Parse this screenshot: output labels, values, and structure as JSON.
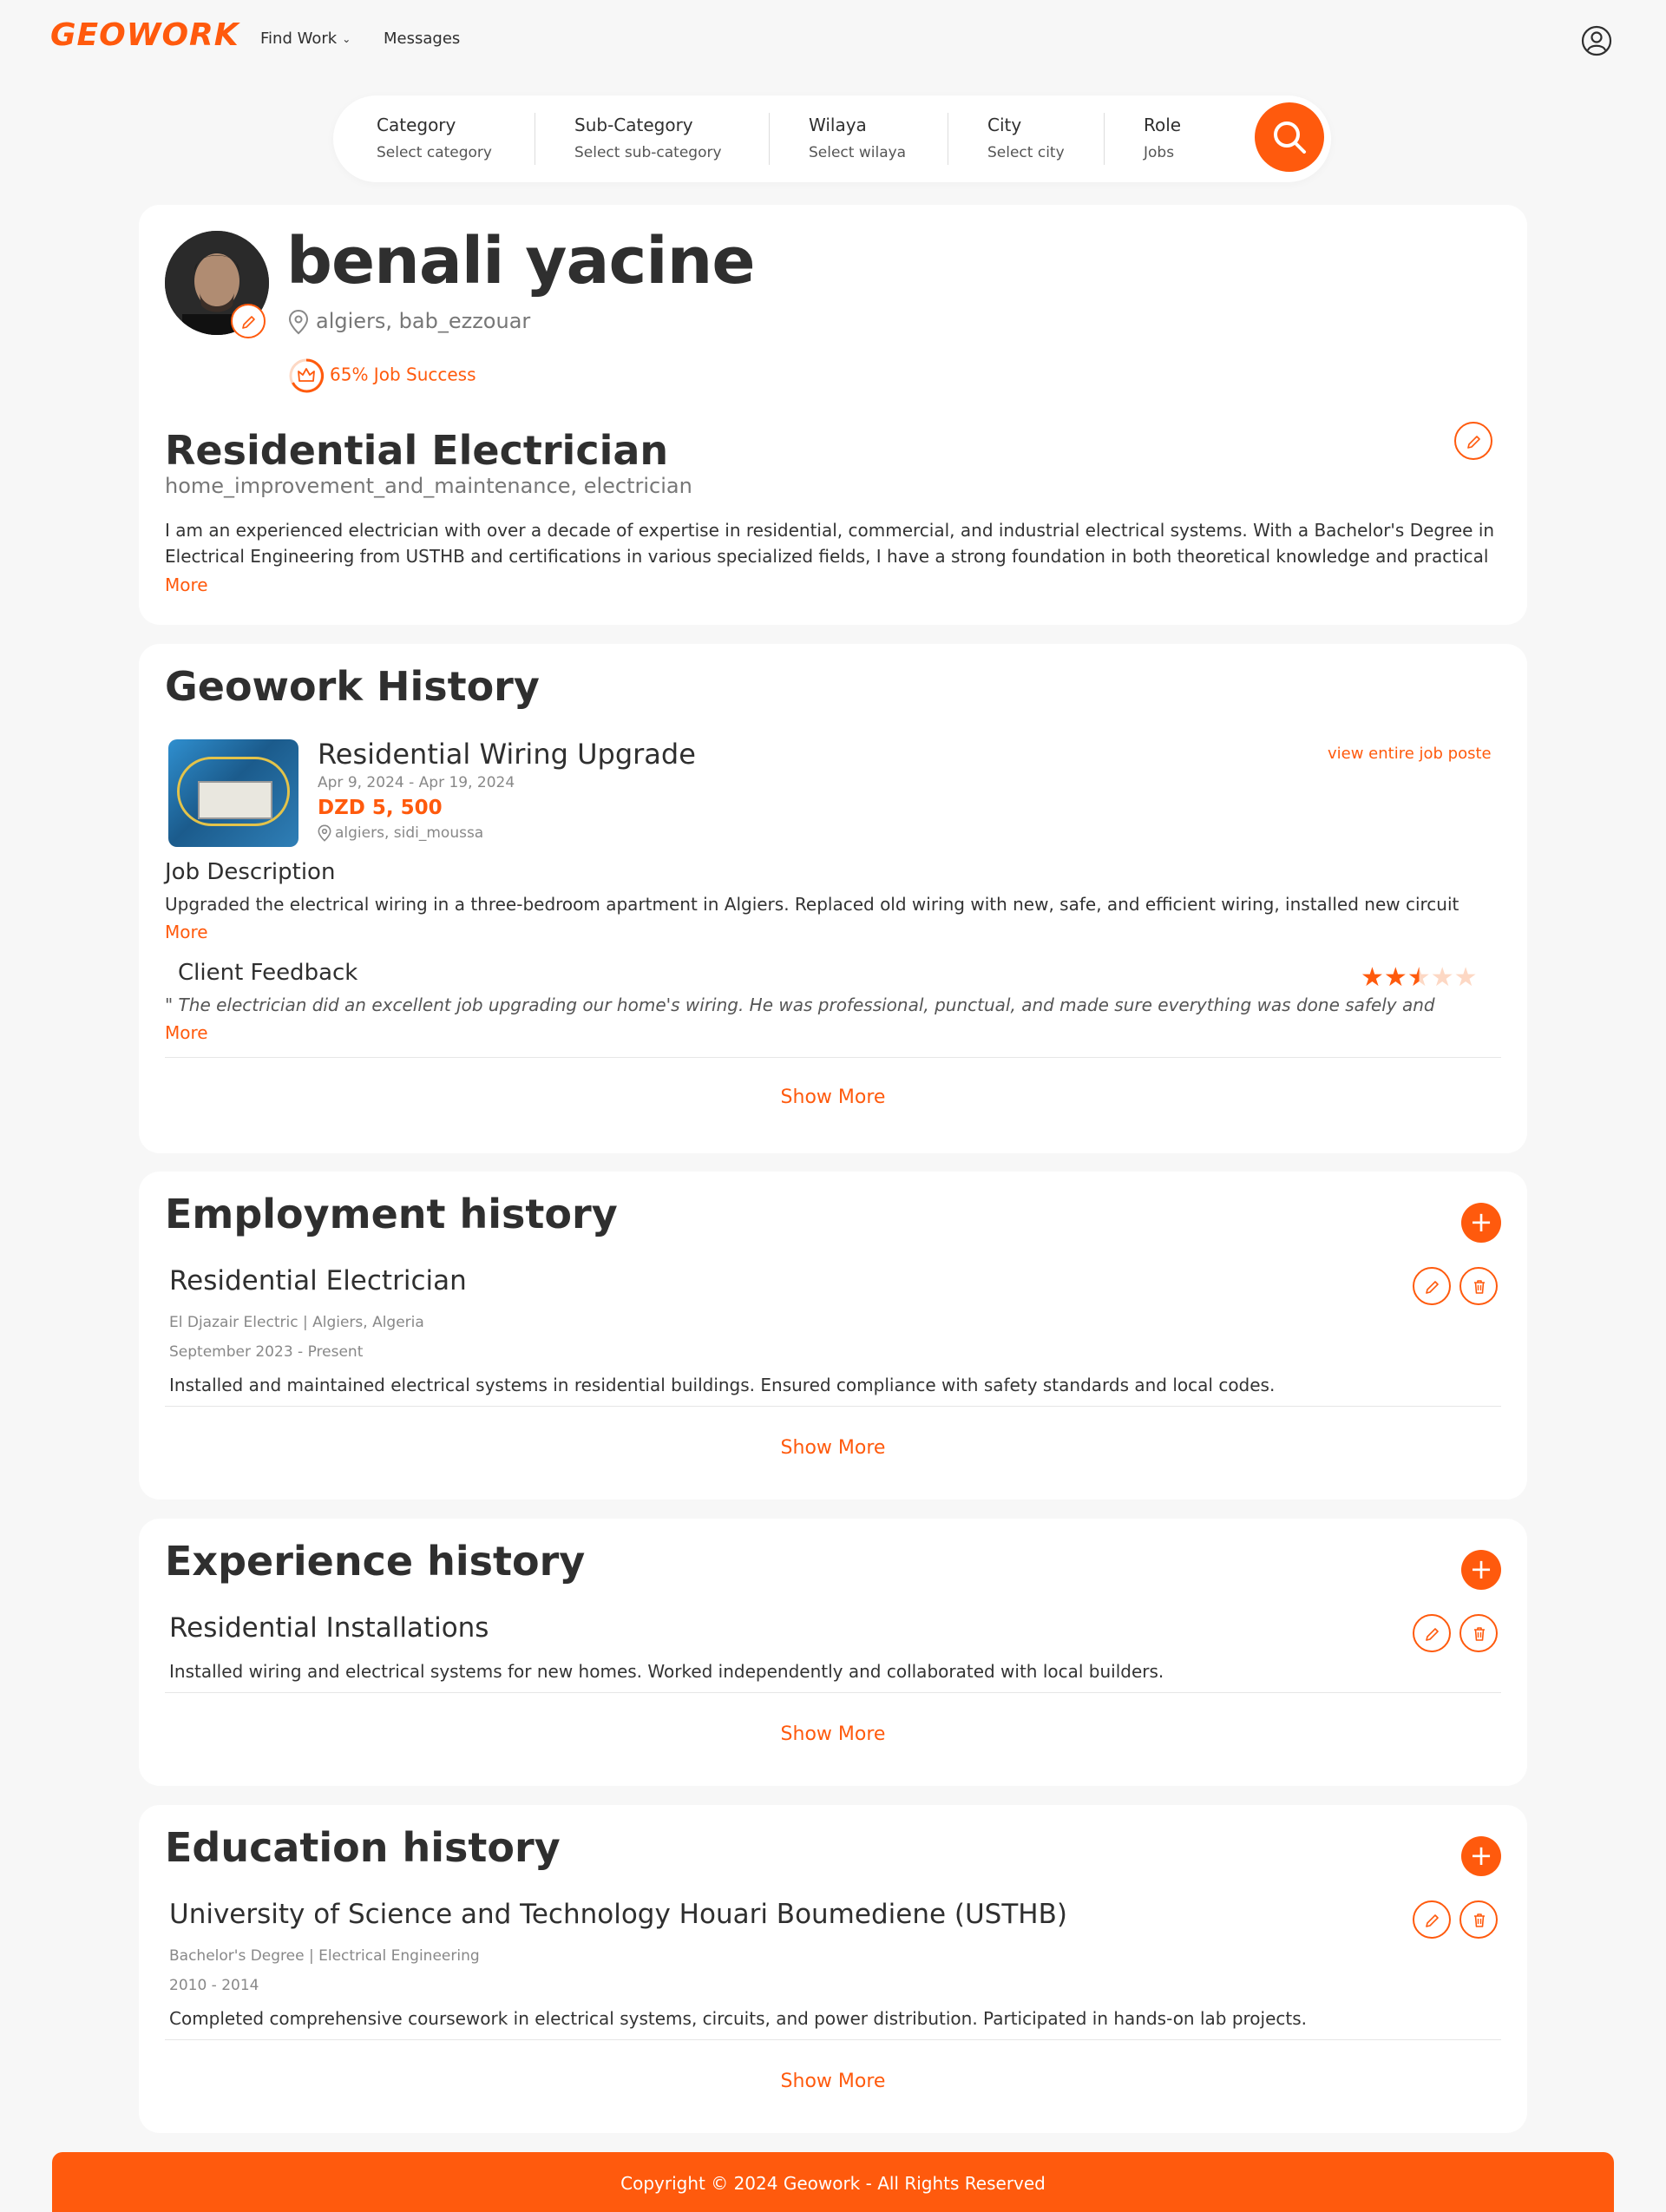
{
  "nav": {
    "logo": "GEOWORK",
    "find_work": "Find Work",
    "messages": "Messages"
  },
  "search": {
    "category_label": "Category",
    "category_value": "Select category",
    "subcategory_label": "Sub-Category",
    "subcategory_value": "Select sub-category",
    "wilaya_label": "Wilaya",
    "wilaya_value": "Select wilaya",
    "city_label": "City",
    "city_value": "Select city",
    "role_label": "Role",
    "role_value": "Jobs"
  },
  "profile": {
    "name": "benali yacine",
    "location": "algiers, bab_ezzouar",
    "job_success": "65% Job Success",
    "job_success_value": 0.65,
    "title": "Residential Electrician",
    "subcategory": "home_improvement_and_maintenance, electrician",
    "bio": "I am an experienced electrician with over a decade of expertise in residential, commercial, and industrial electrical systems. With a Bachelor's Degree in Electrical Engineering from USTHB and certifications in various specialized fields, I have a strong foundation in both theoretical knowledge and practical",
    "more": "More"
  },
  "geowork_history": {
    "title": "Geowork History",
    "job": {
      "title": "Residential Wiring Upgrade",
      "dates": "Apr 9, 2024 - Apr 19, 2024",
      "price": "DZD 5, 500",
      "location": "algiers, sidi_moussa",
      "view_link": "view entire job poste",
      "desc_heading": "Job Description",
      "description": "Upgraded the electrical wiring in a three-bedroom apartment in Algiers. Replaced old wiring with new, safe, and efficient wiring, installed new circuit",
      "more": "More",
      "feedback_heading": "Client Feedback",
      "feedback": "\" The electrician did an excellent job upgrading our home's wiring. He was professional, punctual, and made sure everything was done safely and",
      "feedback_more": "More",
      "rating": 2.5,
      "rating_max": 5
    },
    "show_more": "Show More"
  },
  "employment_history": {
    "title": "Employment history",
    "entry": {
      "title": "Residential Electrician",
      "company": "El Djazair Electric | Algiers, Algeria",
      "dates": "September 2023 - Present",
      "description": "Installed and maintained electrical systems in residential buildings. Ensured compliance with safety standards and local codes."
    },
    "show_more": "Show More"
  },
  "experience_history": {
    "title": "Experience history",
    "entry": {
      "title": "Residential Installations",
      "description": "Installed wiring and electrical systems for new homes. Worked independently and collaborated with local builders."
    },
    "show_more": "Show More"
  },
  "education_history": {
    "title": "Education history",
    "entry": {
      "title": "University of Science and Technology Houari Boumediene (USTHB)",
      "degree": "Bachelor's Degree | Electrical Engineering",
      "dates": "2010 - 2014",
      "description": "Completed comprehensive coursework in electrical systems, circuits, and power distribution. Participated in hands-on lab projects."
    },
    "show_more": "Show More"
  },
  "footer": {
    "copyright": "Copyright © 2024 Geowork - All Rights Reserved"
  },
  "colors": {
    "accent": "#ff5a0d",
    "background": "#f7f7f7",
    "card": "#ffffff",
    "text": "#2f2f2f"
  },
  "icons": [
    "chevron-down-icon",
    "user-icon",
    "search-icon",
    "pencil-icon",
    "location-pin-icon",
    "crown-icon",
    "star-icon",
    "plus-icon",
    "trash-icon"
  ]
}
